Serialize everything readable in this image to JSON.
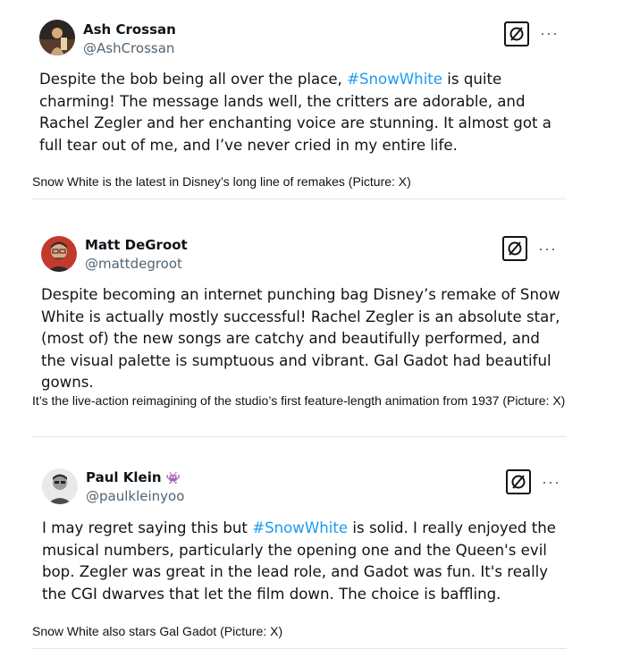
{
  "tweets": [
    {
      "name": "Ash Crossan",
      "handle": "@AshCrossan",
      "text_before": "Despite the bob being all over the place, ",
      "hashtag": "#SnowWhite",
      "text_after": " is quite charming! The message lands well, the critters are adorable, and Rachel Zegler and her enchanting voice are stunning. It almost got a full tear out of me, and I’ve never cried in my entire life.",
      "caption": "Snow White is the latest in Disney’s long line of remakes (Picture: X)"
    },
    {
      "name": "Matt DeGroot",
      "handle": "@mattdegroot",
      "text": "Despite becoming an internet punching bag Disney’s remake of Snow White is actually mostly successful! Rachel Zegler is an absolute star, (most of) the new songs are catchy and beautifully performed, and the visual palette is sumptuous and vibrant. Gal Gadot had beautiful gowns.",
      "caption": "It’s the live-action reimagining of the studio’s first feature-length animation from 1937 (Picture: X)"
    },
    {
      "name": "Paul Klein",
      "handle": "@paulkleinyoo",
      "name_emoji": "👾",
      "text_before": "I may regret saying this but ",
      "hashtag": "#SnowWhite",
      "text_after": " is solid. I really enjoyed the musical numbers, particularly the opening one and the Queen's evil bop. Zegler was great in the lead role, and Gadot was fun. It's really the CGI dwarves that let the film down. The choice is baffling.",
      "caption": "Snow White also stars Gal Gadot (Picture: X)"
    }
  ],
  "icons": {
    "platform": "x-logo-icon",
    "more": "more-options-icon"
  },
  "colors": {
    "hashtag": "#1d9bf0",
    "handle": "#536471",
    "text": "#0f1419",
    "divider": "#e6e6e6"
  }
}
